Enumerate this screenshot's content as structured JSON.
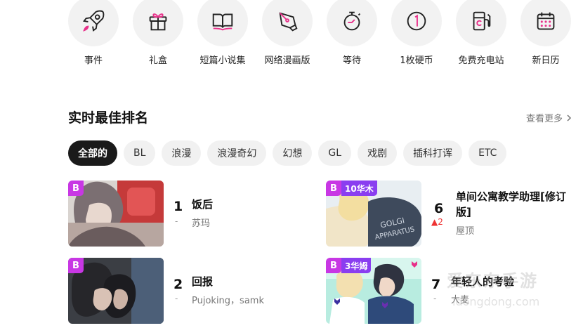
{
  "icons": [
    {
      "label": "事件",
      "icon": "rocket-icon"
    },
    {
      "label": "礼盒",
      "icon": "gift-icon"
    },
    {
      "label": "短篇小说集",
      "icon": "book-icon"
    },
    {
      "label": "网络漫画版",
      "icon": "pen-nib-icon"
    },
    {
      "label": "等待",
      "icon": "stopwatch-icon"
    },
    {
      "label": "1枚硬币",
      "icon": "coin-icon"
    },
    {
      "label": "免费充电站",
      "icon": "charging-station-icon"
    },
    {
      "label": "新日历",
      "icon": "calendar-icon"
    }
  ],
  "ranking": {
    "title": "实时最佳排名",
    "see_more": "查看更多",
    "chips": [
      "全部的",
      "BL",
      "浪漫",
      "浪漫奇幻",
      "幻想",
      "GL",
      "戏剧",
      "插科打诨",
      "ETC"
    ],
    "active_chip": "全部的",
    "items": [
      {
        "rank": "1",
        "title": "饭后",
        "author": "苏玛",
        "change": "-",
        "badge": "B",
        "tag": ""
      },
      {
        "rank": "2",
        "title": "回报",
        "author": "Pujoking，samk",
        "change": "-",
        "badge": "B",
        "tag": ""
      },
      {
        "rank": "6",
        "title": "单间公寓教学助理[修订版]",
        "author": "屋顶",
        "change": "2",
        "change_dir": "up",
        "badge": "B",
        "tag": "10华木"
      },
      {
        "rank": "7",
        "title": "年轻人的考验",
        "author": "大麦",
        "change": "-",
        "badge": "B",
        "tag": "3华姆"
      }
    ]
  },
  "watermark": {
    "line1": "爱东东手游",
    "line2": "idongdong.com"
  },
  "colors": {
    "badge": "#c837e4",
    "tag": "#8a3ef0",
    "accent_icon": "#e8318a",
    "active_chip": "#1a1a1a"
  }
}
